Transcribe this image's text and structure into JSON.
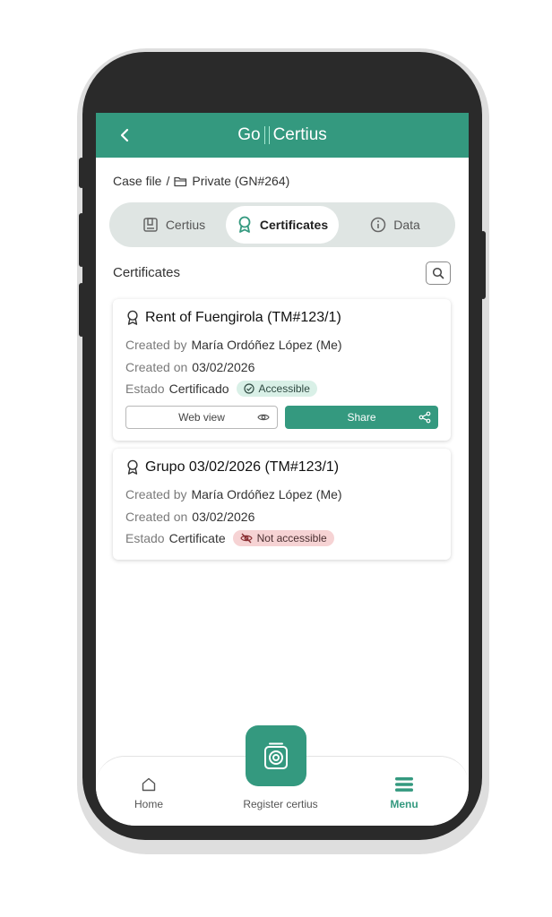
{
  "header": {
    "logo_left": "Go",
    "logo_right": "Certius"
  },
  "breadcrumb": {
    "root": "Case file",
    "separator": "/",
    "current": "Private (GN#264)"
  },
  "tabs": [
    {
      "label": "Certius",
      "icon": "certius-icon",
      "active": false
    },
    {
      "label": "Certificates",
      "icon": "award-icon",
      "active": true
    },
    {
      "label": "Data",
      "icon": "info-icon",
      "active": false
    }
  ],
  "section": {
    "title": "Certificates"
  },
  "certificates": [
    {
      "title": "Rent of Fuengirola (TM#123/1)",
      "created_by_label": "Created by",
      "created_by": "María Ordóñez López (Me)",
      "created_on_label": "Created on",
      "created_on": "03/02/2026",
      "status_label": "Estado",
      "status": "Certificado",
      "access": "Accessible",
      "web_view": "Web view",
      "share": "Share"
    },
    {
      "title": "Grupo 03/02/2026 (TM#123/1)",
      "created_by_label": "Created by",
      "created_by": "María Ordóñez López (Me)",
      "created_on_label": "Created on",
      "created_on": "03/02/2026",
      "status_label": "Estado",
      "status": "Certificate",
      "access": "Not accessible"
    }
  ],
  "nav": {
    "home": "Home",
    "register": "Register certius",
    "menu": "Menu"
  },
  "colors": {
    "primary": "#34997f",
    "accessible_bg": "#d9f0e7",
    "not_accessible_bg": "#f6d3d4"
  }
}
